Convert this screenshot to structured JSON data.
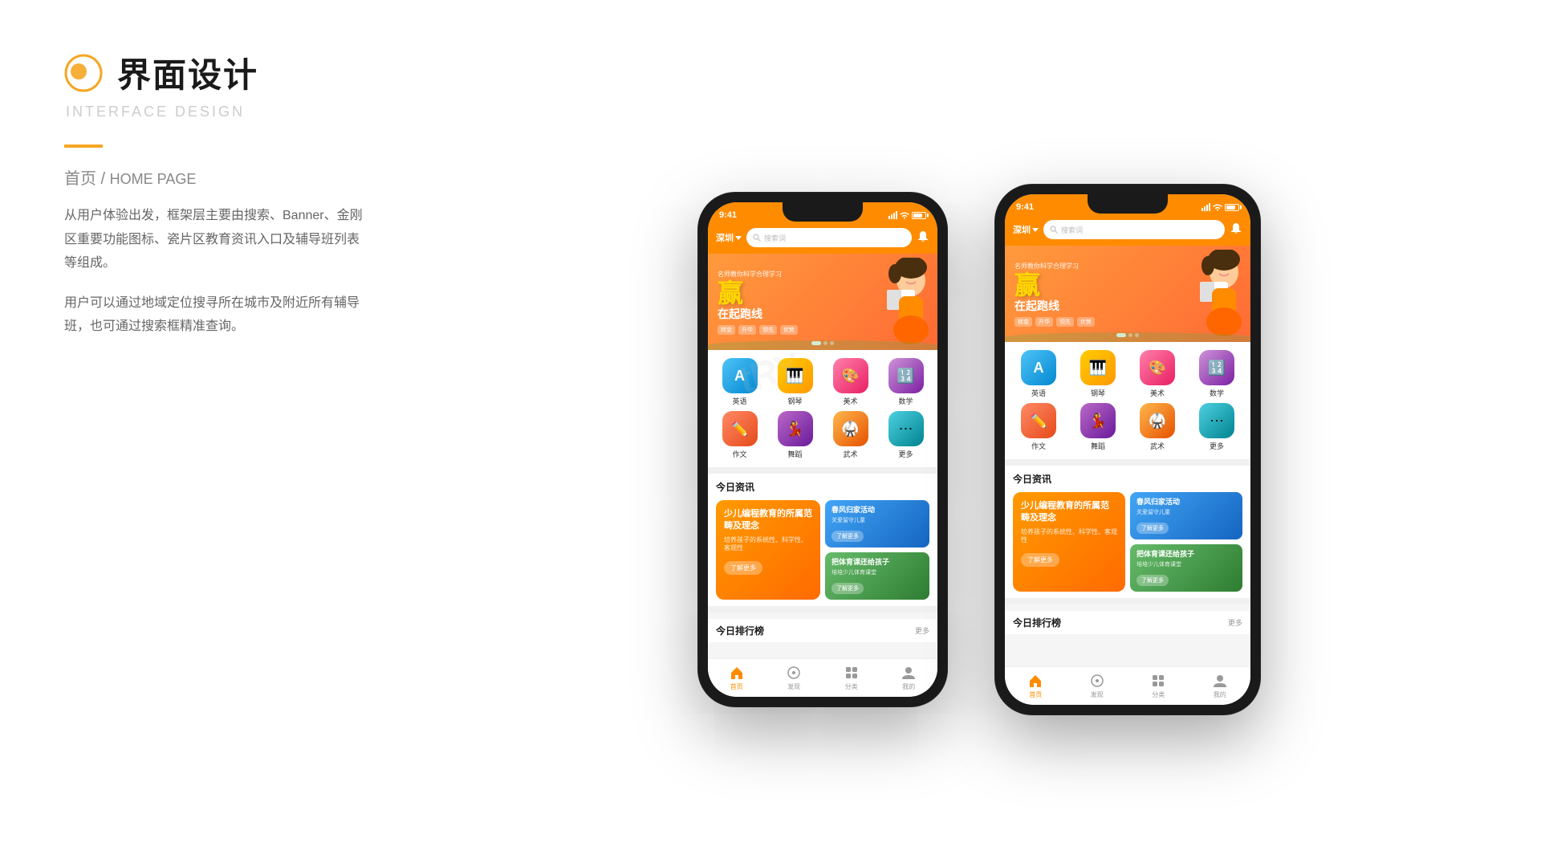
{
  "header": {
    "icon_alt": "circle-logo",
    "title_cn": "界面设计",
    "title_en": "INTERFACE DESIGN"
  },
  "section": {
    "name_cn": "首页",
    "slash": "/",
    "name_en": "HOME PAGE",
    "desc1": "从用户体验出发，框架层主要由搜索、Banner、金刚区重要功能图标、瓷片区教育资讯入口及辅导班列表等组成。",
    "desc2": "用户可以通过地域定位搜寻所在城市及附近所有辅导班，也可通过搜索框精准查询。"
  },
  "phone": {
    "status_time": "9:41",
    "location": "深圳",
    "search_placeholder": "搜索词",
    "banner_subtitle": "名师教你科学合理学习",
    "banner_title_line1": "赢",
    "banner_title_line2": "在起跑线",
    "banner_tag1": "转变",
    "banner_tag2": "升华",
    "banner_tag3": "领先",
    "banner_tag4": "优势",
    "icons": [
      {
        "label": "英语",
        "cls": "icon-english"
      },
      {
        "label": "钢琴",
        "cls": "icon-piano"
      },
      {
        "label": "美术",
        "cls": "icon-art"
      },
      {
        "label": "数学",
        "cls": "icon-math"
      },
      {
        "label": "作文",
        "cls": "icon-writing"
      },
      {
        "label": "舞蹈",
        "cls": "icon-dance"
      },
      {
        "label": "武术",
        "cls": "icon-martial"
      },
      {
        "label": "更多",
        "cls": "icon-more"
      }
    ],
    "news_title": "今日资讯",
    "news_big_title": "少儿编程教育的所属范畴及理念",
    "news_big_desc": "培养孩子的系统性、科学性、客观性",
    "news_big_btn": "了解更多",
    "news_small1_title": "春风归家活动",
    "news_small1_desc": "关爱留守儿童",
    "news_small1_btn": "了解更多",
    "news_small2_title": "把体育课还给孩子",
    "news_small2_desc": "培培少儿体育课堂",
    "news_small2_btn": "了解更多",
    "ranking_title": "今日排行榜",
    "ranking_more": "更多",
    "nav_items": [
      "首页",
      "发现",
      "分类",
      "我的"
    ],
    "nav_active": 0
  },
  "try_watermark": "tRY",
  "colors": {
    "orange": "#ff8c00",
    "banner_bg": "#ff9a3c",
    "card_orange": "#ff8c1a",
    "card_blue": "#3b9de8",
    "card_green": "#4cbb6a"
  }
}
